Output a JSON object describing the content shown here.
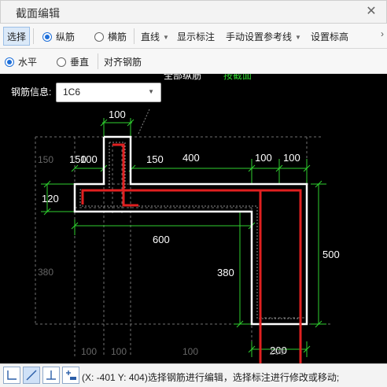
{
  "window": {
    "title": "截面编辑",
    "close_icon": "close-icon"
  },
  "toolbar1": {
    "select_label": "选择",
    "longitudinal_label": "纵筋",
    "stirrup_label": "横筋",
    "line_label": "直线",
    "show_dimension_label": "显示标注",
    "manual_ref_label": "手动设置参考线",
    "set_elevation_label": "设置标高",
    "longitudinal_checked": true,
    "stirrup_checked": false
  },
  "toolbar2": {
    "horizontal_label": "水平",
    "vertical_label": "垂直",
    "align_label": "对齐钢筋",
    "horizontal_checked": true,
    "vertical_checked": false
  },
  "canvas": {
    "top_partial_text_white": "全部纵筋",
    "top_partial_text_green": "按截面",
    "rebar_info_label": "钢筋信息:",
    "rebar_info_value": "1C6",
    "dimensions": {
      "top_100": "100",
      "d_150_left": "150",
      "d_150_right": "150",
      "d_100_left": "100",
      "d_400": "400",
      "d_100_r1": "100",
      "d_100_r2": "100",
      "d_120": "120",
      "d_600": "600",
      "d_380_mid": "380",
      "d_380_left": "380",
      "d_500": "500",
      "d_200": "200",
      "bottom_100_a": "100",
      "bottom_100_b": "100",
      "bottom_100_c": "100",
      "bottom_100_d": "100",
      "left_150": "150"
    },
    "colors": {
      "outline": "#ffffff",
      "rebar": "#e02020",
      "dimension": "#2fd12f",
      "grid": "#6f6f6f"
    }
  },
  "statusbar": {
    "text": "(X: -401 Y: 404)选择钢筋进行编辑，选择标注进行修改或移动;",
    "buttons": [
      "ortho-corner-icon",
      "diagonal-line-icon",
      "perpendicular-icon",
      "add-point-icon"
    ]
  }
}
